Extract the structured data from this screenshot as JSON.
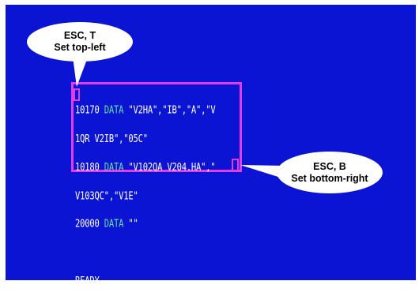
{
  "callouts": {
    "top_left": {
      "line1": "ESC, T",
      "line2": "Set top-left"
    },
    "bottom_right": {
      "line1": "ESC, B",
      "line2": "Set bottom-right"
    }
  },
  "terminal": {
    "lines": [
      {
        "num": "10170",
        "kw": "DATA",
        "rest": " \"V2HA\",\"IB\",\"A\",\"V"
      },
      {
        "num": "1QR V2IB\",\"05C\"",
        "kw": "",
        "rest": ""
      },
      {
        "num": "10180",
        "kw": "DATA",
        "rest": " \"V102QA V204.HA\",\""
      },
      {
        "num": "V103QC\",\"V1E\"",
        "kw": "",
        "rest": ""
      },
      {
        "num": "20000",
        "kw": "DATA",
        "rest": " \"\""
      },
      {
        "num": "",
        "kw": "",
        "rest": ""
      },
      {
        "num": "READY.",
        "kw": "",
        "rest": ""
      }
    ]
  },
  "colors": {
    "screen_background": "#0a14d2",
    "window_border": "#e13ce6",
    "keyword": "#60e0a8",
    "text": "#ffffff"
  }
}
